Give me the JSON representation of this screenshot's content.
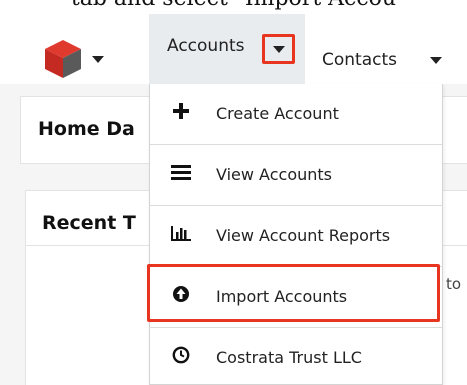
{
  "caption_fragment": "tab and select \"Import Accou",
  "nav": {
    "accounts_label": "Accounts",
    "contacts_label": "Contacts"
  },
  "dashboard": {
    "title": "Home Da",
    "dashlet_title": "Recent T",
    "dashlet_fragment": "to"
  },
  "menu": {
    "items": [
      {
        "label": "Create Account",
        "icon": "plus-icon"
      },
      {
        "label": "View Accounts",
        "icon": "list-icon"
      },
      {
        "label": "View Account Reports",
        "icon": "bar-chart-icon"
      },
      {
        "label": "Import Accounts",
        "icon": "upload-circle-icon"
      },
      {
        "label": "Costrata Trust LLC",
        "icon": "clock-icon"
      }
    ]
  },
  "colors": {
    "highlight": "#e8351f",
    "logo_red": "#e03a2f",
    "logo_gray": "#5a5a5a",
    "accounts_tab_bg": "#e8ecef"
  }
}
